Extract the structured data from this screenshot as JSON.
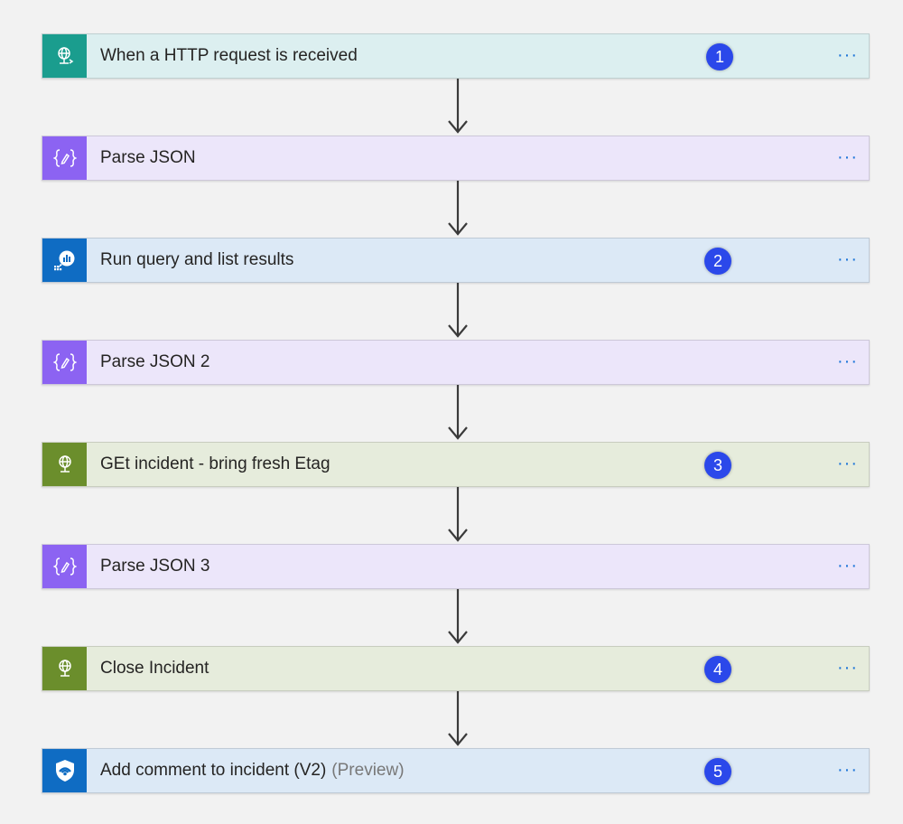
{
  "colors": {
    "background": "#f2f2f2",
    "badge": "#2b48ea",
    "more_menu": "#1a73d8",
    "arrow": "#3a3a3a"
  },
  "steps": [
    {
      "title": "When a HTTP request is received",
      "preview": "",
      "badge": "1",
      "icon": "http-request-trigger-icon",
      "icon_bg": "#1a9d8e",
      "bar_bg": "#dceff0",
      "more": "···"
    },
    {
      "title": "Parse JSON",
      "preview": "",
      "badge": "",
      "icon": "parse-json-icon",
      "icon_bg": "#8c63f2",
      "bar_bg": "#ece6fa",
      "more": "···"
    },
    {
      "title": "Run query and list results",
      "preview": "",
      "badge": "2",
      "icon": "log-analytics-icon",
      "icon_bg": "#0f6cc3",
      "bar_bg": "#dce9f6",
      "more": "···"
    },
    {
      "title": "Parse JSON 2",
      "preview": "",
      "badge": "",
      "icon": "parse-json-icon",
      "icon_bg": "#8c63f2",
      "bar_bg": "#ece6fa",
      "more": "···"
    },
    {
      "title": "GEt incident - bring fresh Etag",
      "preview": "",
      "badge": "3",
      "icon": "http-globe-icon",
      "icon_bg": "#6b8e2c",
      "bar_bg": "#e6ecdc",
      "more": "···"
    },
    {
      "title": "Parse JSON 3",
      "preview": "",
      "badge": "",
      "icon": "parse-json-icon",
      "icon_bg": "#8c63f2",
      "bar_bg": "#ece6fa",
      "more": "···"
    },
    {
      "title": "Close Incident",
      "preview": "",
      "badge": "4",
      "icon": "http-globe-icon",
      "icon_bg": "#6b8e2c",
      "bar_bg": "#e6ecdc",
      "more": "···"
    },
    {
      "title": "Add comment to incident (V2)",
      "preview": "(Preview)",
      "badge": "5",
      "icon": "sentinel-shield-icon",
      "icon_bg": "#0f6cc3",
      "bar_bg": "#dce9f6",
      "more": "···"
    }
  ]
}
